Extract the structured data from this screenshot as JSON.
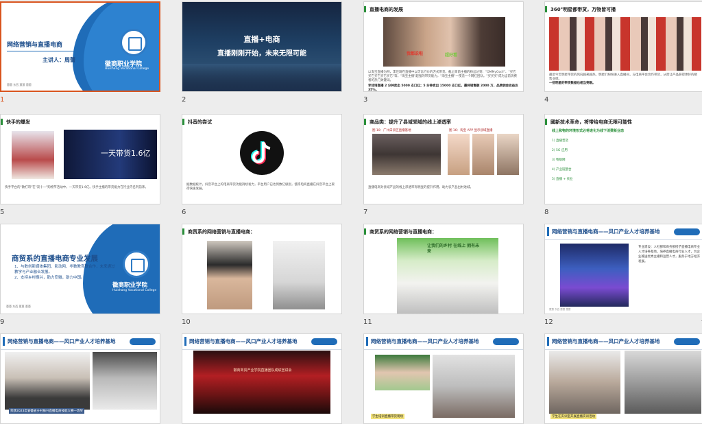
{
  "slides": [
    {
      "number": "1",
      "title": "网络营销与直播电商",
      "presenter": "主讲人：周蕾",
      "school_cn": "徽商职业学院",
      "school_en": "Huishang Vocational College",
      "footer": "蕙蕙 东西 蕙蕙 蕙蕙"
    },
    {
      "number": "2",
      "line1": "直播+电商",
      "line2": "直播刚刚开始，未来无限可能"
    },
    {
      "number": "3",
      "title": "直播电商的发展",
      "caption1": "我都说啦",
      "caption2": "超好看",
      "text": "以淘宝直播为例，李佳琦在直播中以可比行价的方式带货。截止目前主播的粉丝达到：\"OMMyGod!\"、\"买它买它买它买它买它\"等，\"淘宝主播\"超强的带货能力，\"淘宝主播\"一夜造一个网红团队。\"买买买\"成为当前消费者的热门关键词。",
      "highlight": "李佳琦直播 2 分钟卖出 5000 支口红；5 分钟卖出 15000 支口红，最终销售额 2000 万，品牌佣金收益达 35%。"
    },
    {
      "number": "4",
      "title": "360°明星都带货，万物皆可播",
      "text": "最近今年明星带货的风向越来越热。明星们纷纷进入直播间，与电商平台合作带货，从而让产品获得更好的销售业绩。",
      "highlight": "一些明星的带货数据也相当亮眼。"
    },
    {
      "number": "5",
      "title": "快手的爆发",
      "overlay": "一天带货1.6亿",
      "text": "快手平台的\"散打哥\"在\"双十一\"购物节活动中，一天带货1.6亿。快手主播的带货能力在行业内名列前茅。"
    },
    {
      "number": "6",
      "title": "抖音的尝试",
      "text": "据数据统计，抖音平台上的电商带货功能持续发力，平台用户已达到数亿级别，使得电商直播在抖音平台上取得快速发展。"
    },
    {
      "number": "7",
      "title": "商品类：提升了县域领域的线上渗透率",
      "cap1": "图 10：广州白云区直播基地",
      "cap2": "图 16：淘宝 APP 显示县域直播",
      "text": "直播电商对县域产品的线上渗透率有明显的提升作用，助力农产品出村进城。"
    },
    {
      "number": "8",
      "title": "國新技术革命，将带给电商无限可能性",
      "subtitle": "线上和物的环境形式必将进化为线下消费新业态",
      "items": [
        "1) 直播普及",
        "2) 5G 应用",
        "3) 物联网",
        "4) 产业链整合",
        "5) 直播 + 农业"
      ]
    },
    {
      "number": "9",
      "title": "商贸系的直播电商专业发展",
      "points": [
        "1、与数创新媒体集团、影动网、华数教育联合作，未来通过教学与产业融合发展。",
        "2、支持乡村振兴，助力安徽，助力中国。"
      ],
      "school_cn": "徽商职业学院",
      "school_en": "Huishang Vocational College",
      "footer": "蕙蕙 东西 蕙蕙 蕙蕙"
    },
    {
      "number": "10",
      "title": "商贸系的网络营销与直播电商："
    },
    {
      "number": "11",
      "title": "商贸系的网络营销与直播电商：",
      "banner": "让我们的乡村 在线上 拥有未来"
    },
    {
      "number": "12",
      "title": "网络营销与直播电商——风口产业人才培养基地",
      "logo_text": "徽商职业学院",
      "text": "专业建设：人社部和商务部授予直播电商专业人才培养基地，培养直播电商行业人才，为企业输送优秀主播和运营人才，服务于地方经济发展。",
      "footer": "蕙蕙 东西 蕙蕙 蕙蕙"
    },
    {
      "number": "13",
      "title": "网络营销与直播电商——风口产业人才培养基地",
      "logo_text": "徽商职业学院",
      "caption": "荣获2023年安徽省乡村振兴直播电商技能大赛一等奖"
    },
    {
      "number": "14",
      "title": "网络营销与直播电商——风口产业人才培养基地",
      "logo_text": "徽商职业学院",
      "screen": "徽商商贸产业学院直播团队成绩宣讲会"
    },
    {
      "number": "15",
      "title": "网络营销与直播电商——风口产业人才培养基地",
      "logo_text": "徽商职业学院",
      "caption": "学生培训直播带货现场"
    },
    {
      "number": "16",
      "title": "网络营销与直播电商——风口产业人才培养基地",
      "logo_text": "徽商职业学院",
      "caption": "学生在实训室开展直播实训活动"
    }
  ],
  "star_icon": "☆"
}
